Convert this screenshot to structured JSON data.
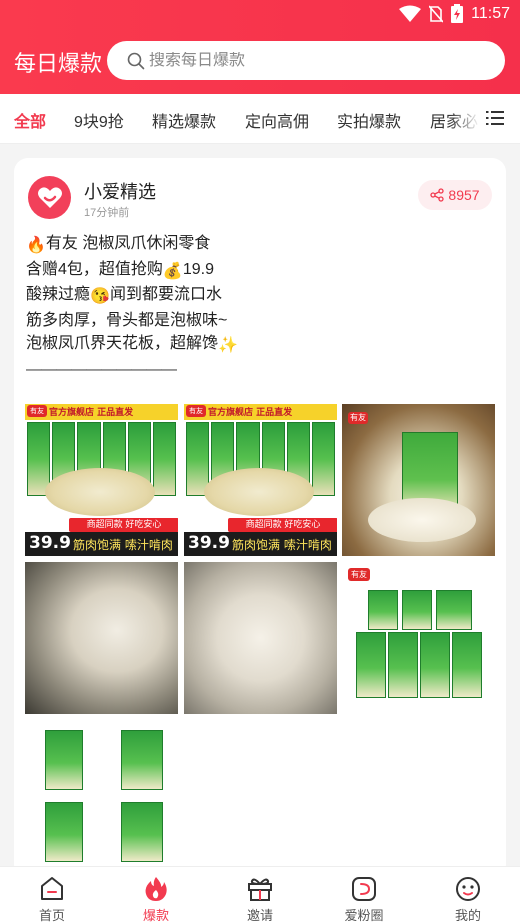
{
  "status": {
    "time": "11:57"
  },
  "header": {
    "title": "每日爆款",
    "search_placeholder": "搜索每日爆款"
  },
  "tabs": [
    {
      "label": "全部",
      "active": true
    },
    {
      "label": "9块9抢"
    },
    {
      "label": "精选爆款"
    },
    {
      "label": "定向高佣"
    },
    {
      "label": "实拍爆款"
    },
    {
      "label": "居家必"
    }
  ],
  "post": {
    "author": "小爱精选",
    "time": "17分钟前",
    "share_count": "8957",
    "lines": [
      {
        "emoji": "🔥",
        "text": "有友 泡椒凤爪休闲零食"
      },
      {
        "text": "含赠4包，超值抢购",
        "emoji_after": "💰",
        "text_after": "19.9"
      },
      {
        "text": "酸辣过瘾",
        "emoji_after": "😘",
        "text_after": "闻到都要流口水"
      },
      {
        "text": "筋多肉厚，骨头都是泡椒味~"
      },
      {
        "text": "泡椒凤爪界天花板，超解馋",
        "emoji_after": "✨"
      },
      {
        "text": "——————————"
      }
    ],
    "images": [
      {
        "kind": "pack",
        "banner": "官方旗舰店 正品直发",
        "logo": "有友",
        "tagline": "商超同款 好吃安心",
        "price": "39.9",
        "slogan": "筋肉饱满 嗦汁啃肉"
      },
      {
        "kind": "pack",
        "banner": "官方旗舰店 正品直发",
        "logo": "有友",
        "tagline": "商超同款 好吃安心",
        "price": "39.9",
        "slogan": "筋肉饱满 嗦汁啃肉"
      },
      {
        "kind": "bowl",
        "logo": "有友"
      },
      {
        "kind": "feet"
      },
      {
        "kind": "feet"
      },
      {
        "kind": "bags",
        "logo": "有友"
      },
      {
        "kind": "small-bags"
      }
    ]
  },
  "bottom_nav": [
    {
      "label": "首页",
      "icon": "home-icon"
    },
    {
      "label": "爆款",
      "icon": "flame-icon",
      "active": true
    },
    {
      "label": "邀请",
      "icon": "gift-icon"
    },
    {
      "label": "爱粉圈",
      "icon": "circle-d-icon"
    },
    {
      "label": "我的",
      "icon": "face-icon"
    }
  ],
  "colors": {
    "brand": "#f23a4f",
    "header": "#f5304b"
  }
}
